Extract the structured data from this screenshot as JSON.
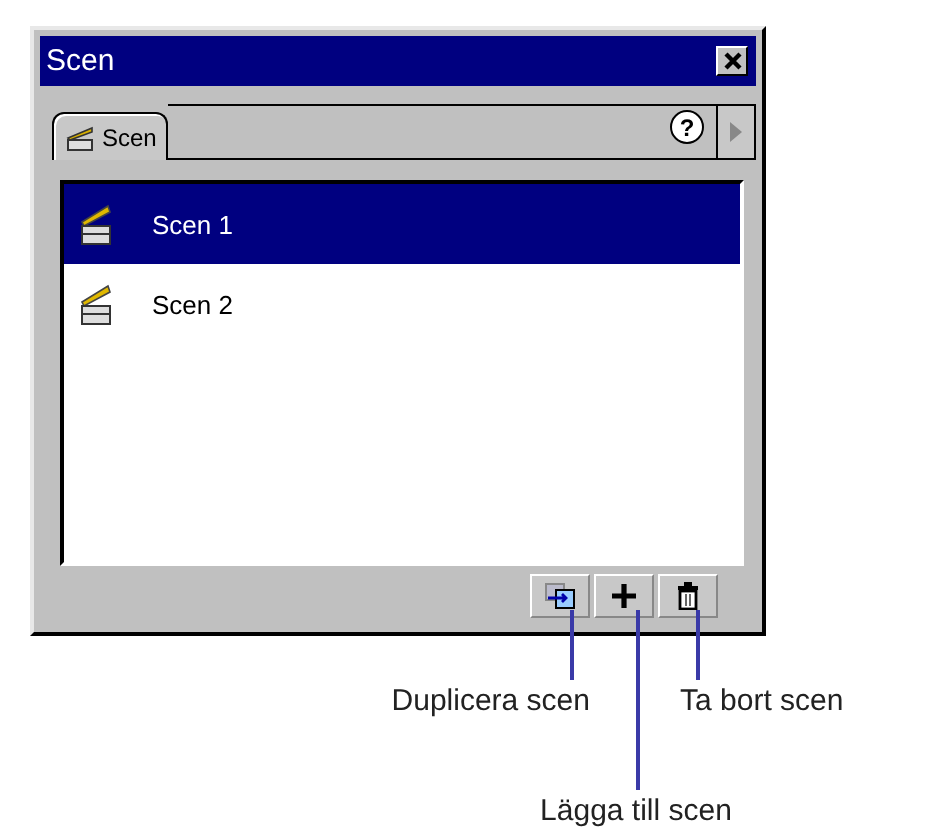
{
  "window": {
    "title": "Scen"
  },
  "tabs": [
    {
      "label": "Scen",
      "selected": true
    }
  ],
  "help": "?",
  "scenes": [
    {
      "label": "Scen 1",
      "selected": true
    },
    {
      "label": "Scen 2",
      "selected": false
    }
  ],
  "callouts": [
    {
      "text": "Duplicera scen"
    },
    {
      "text": "Lägga till scen"
    },
    {
      "text": "Ta bort scen"
    }
  ]
}
